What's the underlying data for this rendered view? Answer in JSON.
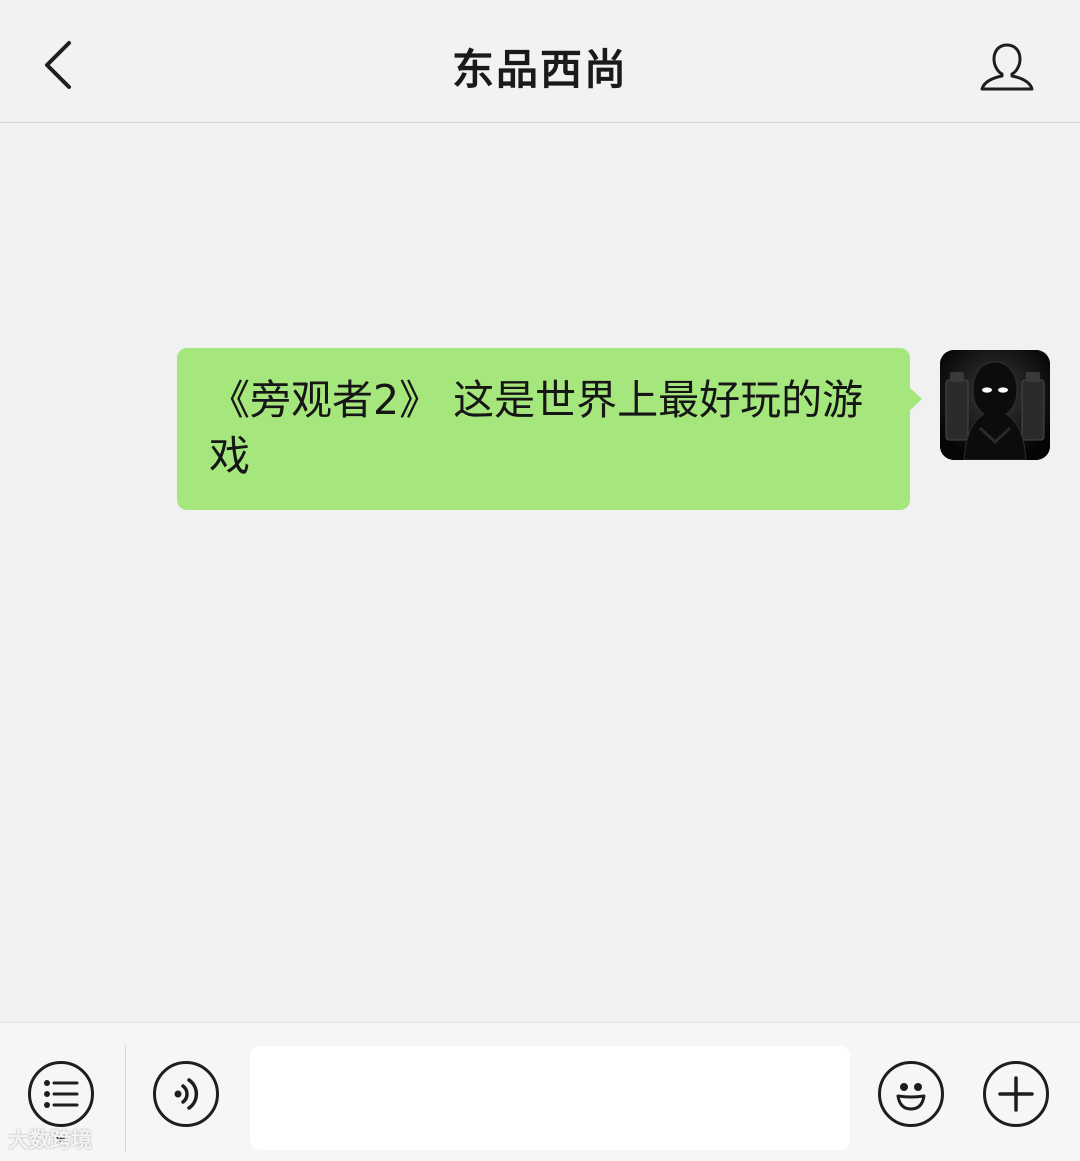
{
  "header": {
    "title": "东品西尚",
    "back_icon": "chevron-left-icon",
    "profile_icon": "person-icon"
  },
  "conversation": {
    "messages": [
      {
        "direction": "outgoing",
        "text": "《旁观者2》 这是世界上最好玩的游戏",
        "bubble_color": "#a5e77c",
        "avatar": "game-avatar"
      }
    ]
  },
  "input_bar": {
    "menu_icon": "list-menu-icon",
    "voice_icon": "voice-icon",
    "message_value": "",
    "emoji_icon": "emoji-icon",
    "plus_icon": "plus-icon"
  },
  "watermark": {
    "text": "大数跨境"
  }
}
